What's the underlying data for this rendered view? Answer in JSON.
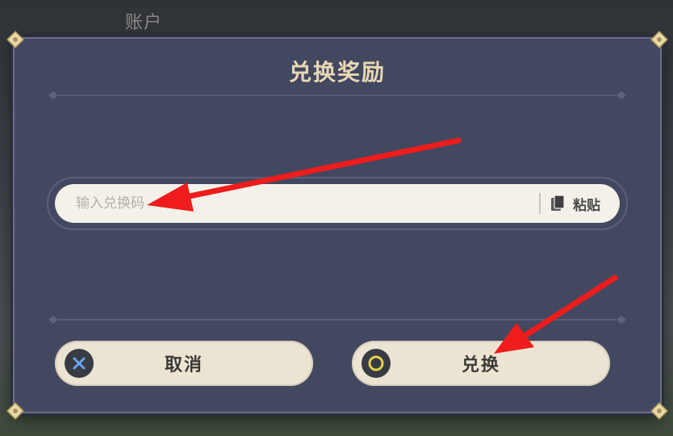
{
  "background": {
    "label": "账户"
  },
  "dialog": {
    "title": "兑换奖励",
    "input": {
      "placeholder": "输入兑换码",
      "value": ""
    },
    "paste_label": "粘贴",
    "cancel_label": "取消",
    "confirm_label": "兑换"
  },
  "icons": {
    "paste": "clipboard-icon",
    "cancel": "x-circle-icon",
    "confirm": "o-circle-icon"
  },
  "colors": {
    "dialog_bg": "#434861",
    "title": "#e8d7b4",
    "button_bg": "#ebe4d3",
    "input_bg": "#f4f1ea",
    "cancel_icon": "#6aa6e8",
    "confirm_icon": "#e3d24a",
    "annotation_arrow": "#ee1c1c"
  }
}
